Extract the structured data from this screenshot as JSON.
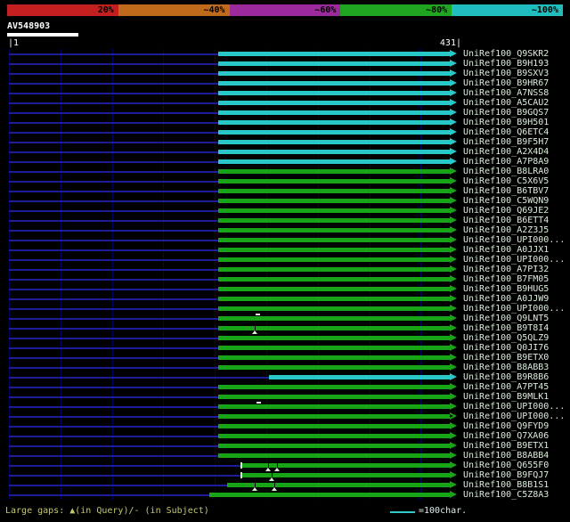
{
  "scale_bar": {
    "segments": [
      {
        "label": "20%",
        "color": "#c41f1f"
      },
      {
        "label": "~40%",
        "color": "#c06a1e"
      },
      {
        "label": "~60%",
        "color": "#9c2a9c"
      },
      {
        "label": "~80%",
        "color": "#1fa51f"
      },
      {
        "label": "~100%",
        "color": "#1fbdbd"
      }
    ]
  },
  "query": {
    "name": "AV548903",
    "start_label": "|1",
    "end_label": "431|",
    "length": 431
  },
  "legend": {
    "gaps_text": "Large gaps: ▲(in Query)/- (in Subject)",
    "scale_text": "=100char."
  },
  "colors": {
    "cyan": "#28c8c8",
    "green": "#17a517",
    "track": "#1d1d99",
    "grid": "#00005e",
    "label": "#d9eed9"
  },
  "chart_data": {
    "type": "alignment-overview",
    "title": "BLAST hit overview for query AV548903",
    "query": "AV548903",
    "axis_min": 1,
    "axis_max": 431,
    "grid_step": 50,
    "color_key": {
      "cyan": "~100% identity",
      "green": "~80% identity"
    },
    "rows": [
      {
        "label": "UniRef100_Q9SKR2",
        "color": "cyan",
        "start": 204,
        "end": 429
      },
      {
        "label": "UniRef100_B9H193",
        "color": "cyan",
        "start": 204,
        "end": 429
      },
      {
        "label": "UniRef100_B9SXV3",
        "color": "cyan",
        "start": 204,
        "end": 429
      },
      {
        "label": "UniRef100_B9HR67",
        "color": "cyan",
        "start": 204,
        "end": 429
      },
      {
        "label": "UniRef100_A7NSS8",
        "color": "cyan",
        "start": 204,
        "end": 429
      },
      {
        "label": "UniRef100_A5CAU2",
        "color": "cyan",
        "start": 204,
        "end": 429
      },
      {
        "label": "UniRef100_B9GQS7",
        "color": "cyan",
        "start": 204,
        "end": 429
      },
      {
        "label": "UniRef100_B9H501",
        "color": "cyan",
        "start": 204,
        "end": 429
      },
      {
        "label": "UniRef100_Q6ETC4",
        "color": "cyan",
        "start": 204,
        "end": 429
      },
      {
        "label": "UniRef100_B9F5H7",
        "color": "cyan",
        "start": 204,
        "end": 429
      },
      {
        "label": "UniRef100_A2X4D4",
        "color": "cyan",
        "start": 204,
        "end": 429
      },
      {
        "label": "UniRef100_A7P8A9",
        "color": "cyan",
        "start": 204,
        "end": 429
      },
      {
        "label": "UniRef100_B8LRA0",
        "color": "green",
        "start": 204,
        "end": 429
      },
      {
        "label": "UniRef100_C5X6V5",
        "color": "green",
        "start": 204,
        "end": 429
      },
      {
        "label": "UniRef100_B6TBV7",
        "color": "green",
        "start": 204,
        "end": 429
      },
      {
        "label": "UniRef100_C5WQN9",
        "color": "green",
        "start": 204,
        "end": 429
      },
      {
        "label": "UniRef100_Q69JE2",
        "color": "green",
        "start": 204,
        "end": 429
      },
      {
        "label": "UniRef100_B6ETT4",
        "color": "green",
        "start": 204,
        "end": 429
      },
      {
        "label": "UniRef100_A2Z3J5",
        "color": "green",
        "start": 204,
        "end": 429
      },
      {
        "label": "UniRef100_UPI000...",
        "color": "green",
        "start": 204,
        "end": 429
      },
      {
        "label": "UniRef100_A0JJX1",
        "color": "green",
        "start": 204,
        "end": 429
      },
      {
        "label": "UniRef100_UPI000...",
        "color": "green",
        "start": 204,
        "end": 429
      },
      {
        "label": "UniRef100_A7PI32",
        "color": "green",
        "start": 204,
        "end": 429
      },
      {
        "label": "UniRef100_B7FM05",
        "color": "green",
        "start": 204,
        "end": 429
      },
      {
        "label": "UniRef100_B9HUG5",
        "color": "green",
        "start": 204,
        "end": 429
      },
      {
        "label": "UniRef100_A0JJW9",
        "color": "green",
        "start": 204,
        "end": 429
      },
      {
        "label": "UniRef100_UPI000...",
        "color": "green",
        "start": 204,
        "end": 429
      },
      {
        "label": "UniRef100_Q9LNT5",
        "color": "green",
        "start": 204,
        "end": 429,
        "markers": [
          {
            "type": "dash",
            "pos": 242
          }
        ]
      },
      {
        "label": "UniRef100_B9T8I4",
        "color": "green",
        "start": 204,
        "end": 429,
        "markers": [
          {
            "type": "tri",
            "pos": 240
          }
        ]
      },
      {
        "label": "UniRef100_Q5QLZ9",
        "color": "green",
        "start": 204,
        "end": 429
      },
      {
        "label": "UniRef100_Q0JI76",
        "color": "green",
        "start": 204,
        "end": 429
      },
      {
        "label": "UniRef100_B9ETX0",
        "color": "green",
        "start": 204,
        "end": 429
      },
      {
        "label": "UniRef100_B8ABB3",
        "color": "green",
        "start": 204,
        "end": 429
      },
      {
        "label": "UniRef100_B9R8B6",
        "color": "cyan",
        "start": 254,
        "end": 429
      },
      {
        "label": "UniRef100_A7PT45",
        "color": "green",
        "start": 204,
        "end": 429
      },
      {
        "label": "UniRef100_B9MLK1",
        "color": "green",
        "start": 204,
        "end": 429
      },
      {
        "label": "UniRef100_UPI000...",
        "color": "green",
        "start": 204,
        "end": 429,
        "markers": [
          {
            "type": "dash",
            "pos": 243
          }
        ]
      },
      {
        "label": "UniRef100_UPI000...",
        "color": "green",
        "start": 204,
        "end": 429,
        "arrow": "open"
      },
      {
        "label": "UniRef100_Q9FYD9",
        "color": "green",
        "start": 204,
        "end": 429
      },
      {
        "label": "UniRef100_Q7XA06",
        "color": "green",
        "start": 204,
        "end": 429
      },
      {
        "label": "UniRef100_B9ETX1",
        "color": "green",
        "start": 204,
        "end": 429
      },
      {
        "label": "UniRef100_B8ABB4",
        "color": "green",
        "start": 204,
        "end": 429
      },
      {
        "label": "UniRef100_Q655F0",
        "color": "green",
        "start": 226,
        "end": 429,
        "markers": [
          {
            "type": "tick",
            "pos": 226
          },
          {
            "type": "tri",
            "pos": 253
          },
          {
            "type": "tri",
            "pos": 261
          }
        ]
      },
      {
        "label": "UniRef100_B9FQJ7",
        "color": "green",
        "start": 226,
        "end": 429,
        "markers": [
          {
            "type": "tick",
            "pos": 226
          },
          {
            "type": "tri",
            "pos": 256
          }
        ]
      },
      {
        "label": "UniRef100_B8B1S1",
        "color": "green",
        "start": 213,
        "end": 429,
        "markers": [
          {
            "type": "tri",
            "pos": 240
          },
          {
            "type": "tri",
            "pos": 259
          }
        ]
      },
      {
        "label": "UniRef100_C5Z8A3",
        "color": "green",
        "start": 196,
        "end": 429
      }
    ]
  }
}
